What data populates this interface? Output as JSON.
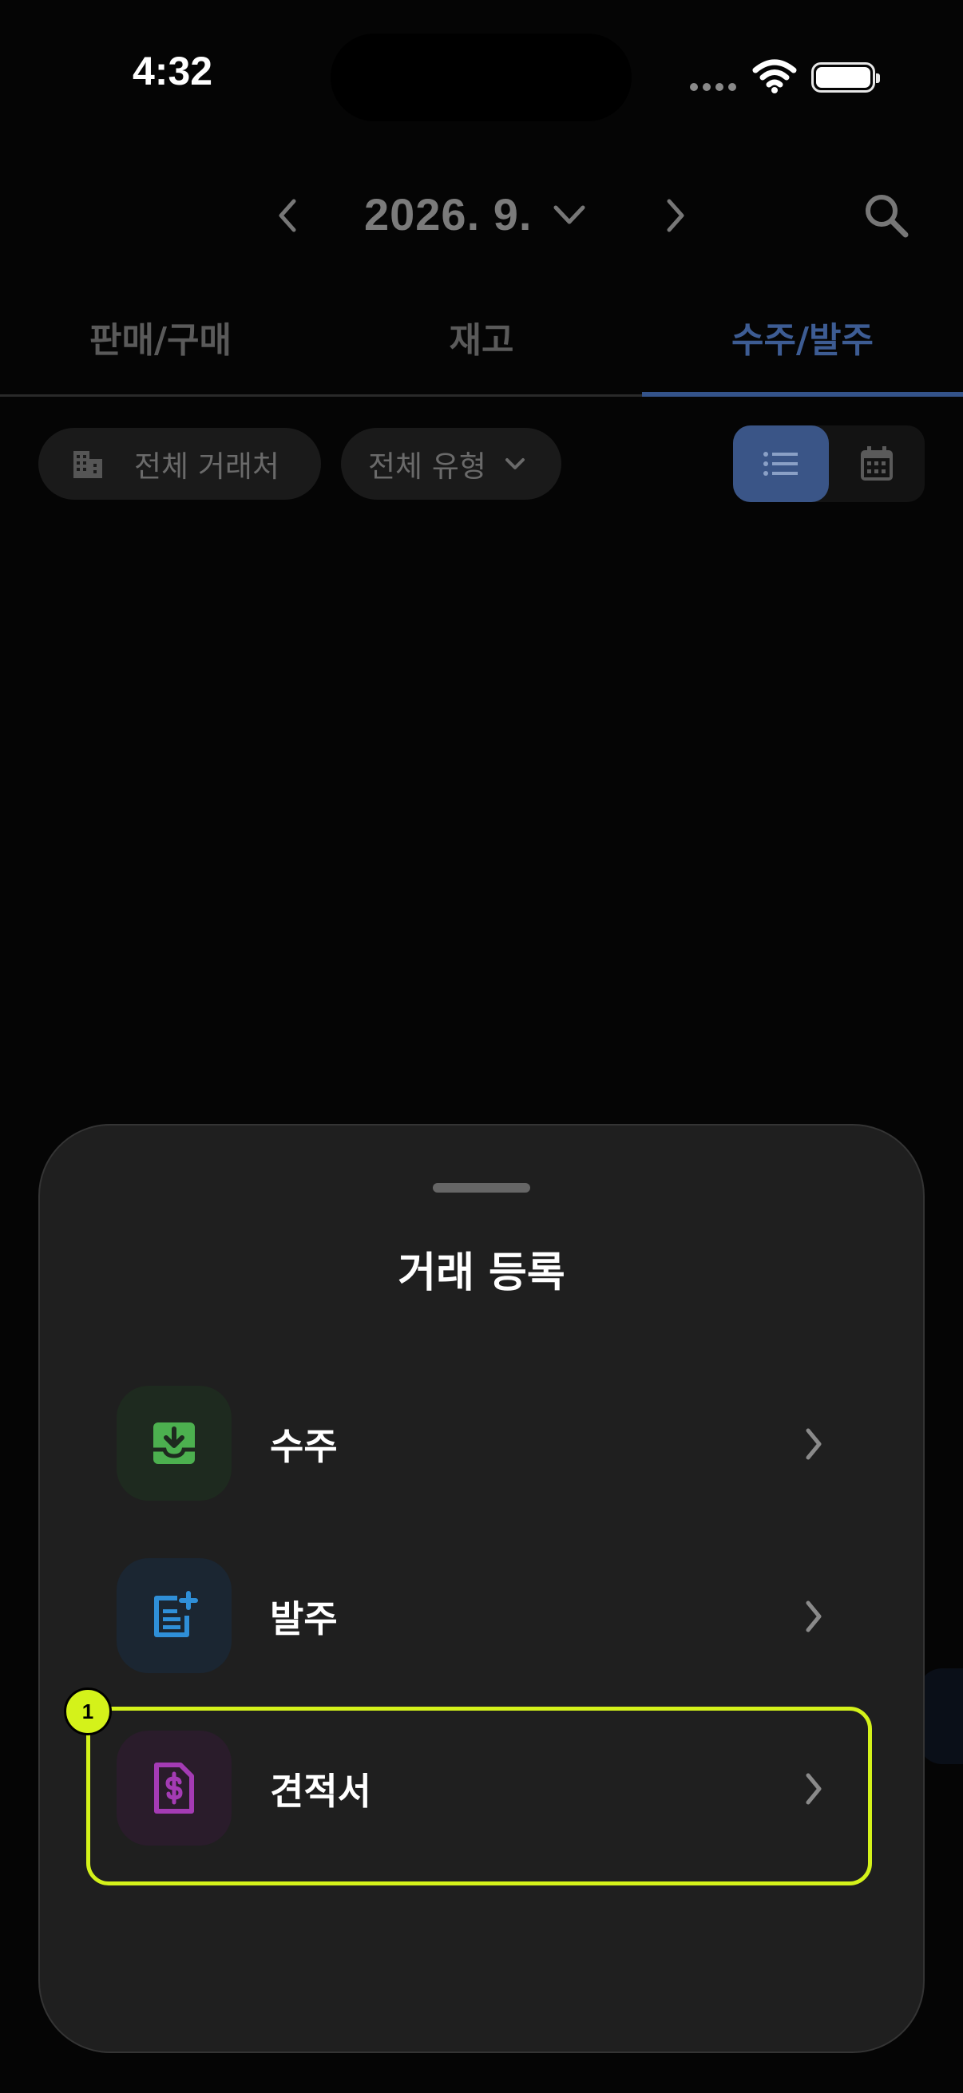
{
  "status_bar": {
    "time": "4:32"
  },
  "header": {
    "month": "2026. 9."
  },
  "tabs": [
    {
      "label": "판매/구매",
      "active": false
    },
    {
      "label": "재고",
      "active": false
    },
    {
      "label": "수주/발주",
      "active": true
    }
  ],
  "filters": {
    "vendor": "전체 거래처",
    "type": "전체 유형",
    "view_mode": "list"
  },
  "sheet": {
    "title": "거래 등록",
    "items": [
      {
        "label": "수주",
        "icon": "inbox-download-icon",
        "icon_color": "#4cb04f",
        "icon_bg": "#1e2a1f"
      },
      {
        "label": "발주",
        "icon": "document-add-icon",
        "icon_color": "#2f8fd8",
        "icon_bg": "#1b2632"
      },
      {
        "label": "견적서",
        "icon": "invoice-dollar-icon",
        "icon_color": "#a43bb4",
        "icon_bg": "#2a1c2b"
      }
    ]
  },
  "annotation": {
    "badge": "1",
    "color": "#d4f21a"
  }
}
